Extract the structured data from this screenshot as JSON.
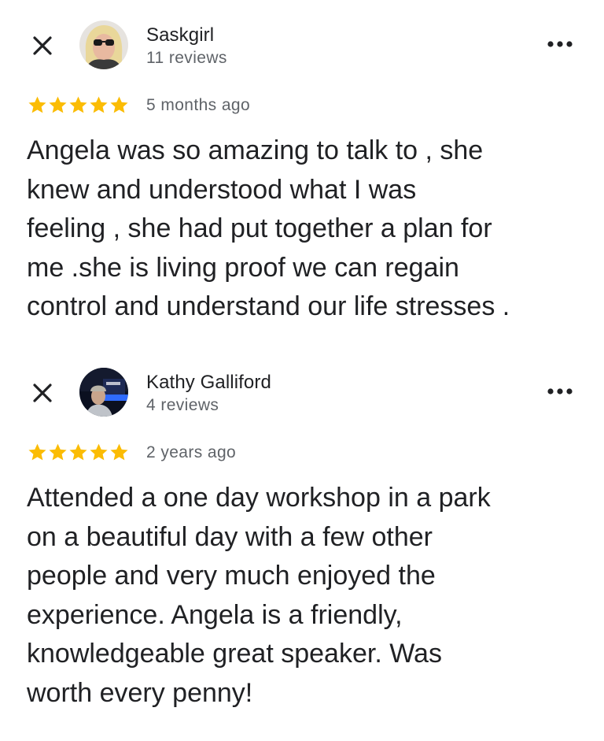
{
  "colors": {
    "star": "#FBBC04",
    "primary_text": "#202124",
    "secondary_text": "#5F6368",
    "icon": "#202124"
  },
  "reviews": [
    {
      "author": "Saskgirl",
      "review_count": "11 reviews",
      "rating": 5,
      "time": "5 months ago",
      "text": "Angela was so amazing to talk to , she\nknew and understood what I was\nfeeling , she had put together a plan for\nme .she is living proof we can regain\ncontrol and understand our life stresses .",
      "icons": {
        "close": "close-icon",
        "more": "more-horiz-icon",
        "star": "star-icon"
      }
    },
    {
      "author": "Kathy Galliford",
      "review_count": "4 reviews",
      "rating": 5,
      "time": "2 years ago",
      "text": "Attended a one day workshop in a park\non a beautiful day with a few other\npeople and very much enjoyed the\nexperience.  Angela is a friendly,\nknowledgeable great speaker.  Was\nworth every penny!",
      "icons": {
        "close": "close-icon",
        "more": "more-horiz-icon",
        "star": "star-icon"
      }
    }
  ]
}
